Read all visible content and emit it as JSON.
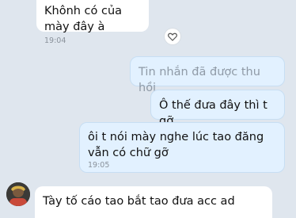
{
  "messages": [
    {
      "text": "Khônh có của mày đây à",
      "time": "19:04"
    },
    {
      "text": "Tin nhắn đã được thu hồi"
    },
    {
      "text": "Ô thế đưa đây thì t gỡ"
    },
    {
      "text": "ôi t nói mày nghe lúc tao đăng vẫn có chữ gỡ",
      "time": "19:05"
    },
    {
      "text": "Tày tố cáo tao bắt tao đưa acc ad"
    }
  ],
  "icons": {
    "reaction": "heart-outline-icon",
    "avatar": "user-avatar"
  },
  "colors": {
    "background": "#dfe6ee",
    "incoming": "#ffffff",
    "outgoing": "#e2f1ff",
    "recalled_text": "#8f9aa6"
  }
}
